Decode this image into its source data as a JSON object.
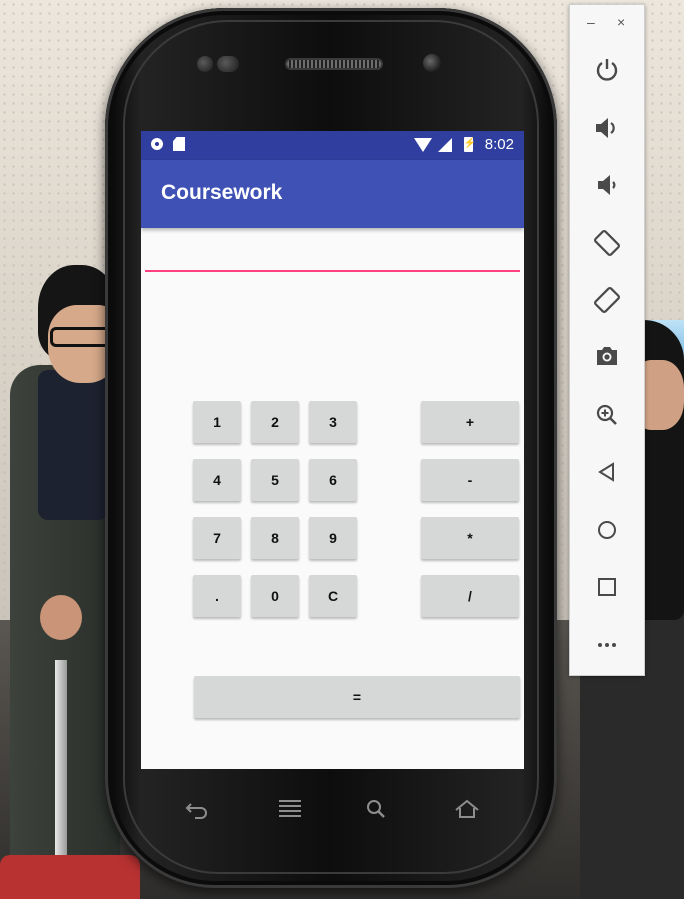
{
  "status_bar": {
    "time": "8:02",
    "left_icons": [
      "circle-icon",
      "sd-card-icon"
    ],
    "right_icons": [
      "wifi-icon",
      "signal-icon",
      "battery-charging-icon"
    ]
  },
  "app": {
    "title": "Coursework",
    "display": {
      "value": "",
      "placeholder": ""
    }
  },
  "keypad": {
    "digits": [
      "1",
      "2",
      "3",
      "4",
      "5",
      "6",
      "7",
      "8",
      "9",
      ".",
      "0",
      "C"
    ],
    "operators": [
      "+",
      "-",
      "*",
      "/"
    ],
    "equals": "="
  },
  "navigation_bar": [
    "back-icon",
    "menu-icon",
    "search-icon",
    "home-icon"
  ],
  "emulator_toolbar": {
    "window_controls": {
      "minimize": "–",
      "close": "×"
    },
    "buttons": [
      "power",
      "volume-up",
      "volume-down",
      "rotate-left",
      "rotate-right",
      "screenshot",
      "zoom",
      "back",
      "home",
      "overview",
      "more"
    ]
  },
  "colors": {
    "status_bar": "#303f9f",
    "app_bar": "#3f51b5",
    "accent": "#ff4081",
    "button": "#d6d7d7",
    "screen_background": "#fafafa"
  }
}
